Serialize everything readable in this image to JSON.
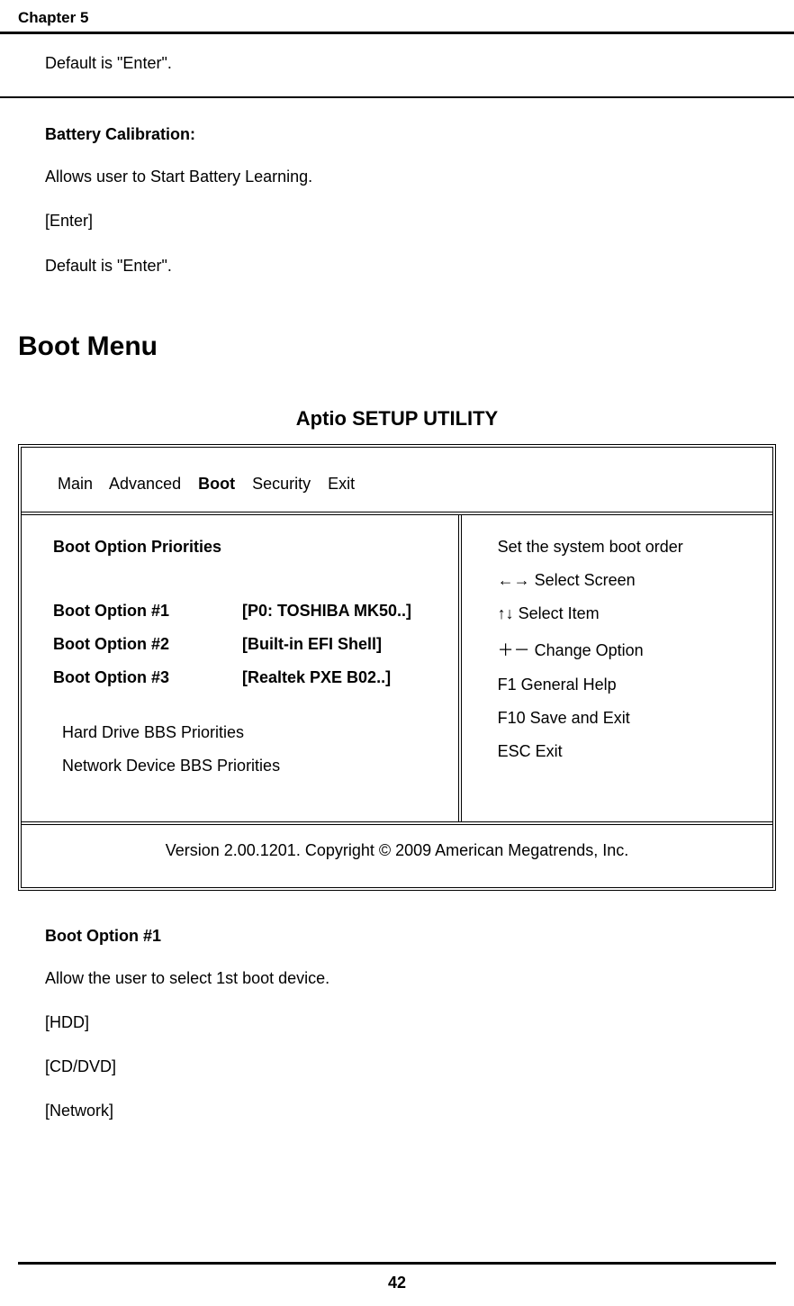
{
  "header": {
    "chapter": "Chapter 5"
  },
  "block1": {
    "default_enter": "Default is \"Enter\"."
  },
  "battery": {
    "title": "Battery Calibration:",
    "desc": "Allows user to Start Battery Learning.",
    "option": "[Enter]",
    "default": "Default is \"Enter\"."
  },
  "boot_menu": {
    "heading": "Boot Menu"
  },
  "setup": {
    "title": "Aptio SETUP UTILITY",
    "tabs": {
      "main": "Main",
      "advanced": "Advanced",
      "boot": "Boot",
      "security": "Security",
      "exit": "Exit"
    },
    "left": {
      "priorities_title": "Boot Option Priorities",
      "rows": [
        {
          "label": "Boot Option #1",
          "value": "[P0: TOSHIBA MK50..]"
        },
        {
          "label": "Boot Option #2",
          "value": "[Built-in EFI Shell]"
        },
        {
          "label": "Boot Option #3",
          "value": "[Realtek PXE B02..]"
        }
      ],
      "bbs1": "Hard Drive BBS Priorities",
      "bbs2": "Network Device BBS Priorities"
    },
    "right": {
      "line1": "Set the system boot order",
      "line2": "←→ Select Screen",
      "line3": "↑↓ Select Item",
      "line4": "＋－ Change Option",
      "line5": "F1  General Help",
      "line6": "F10 Save and Exit",
      "line7": "ESC Exit"
    },
    "footer": "Version 2.00.1201. Copyright © 2009 American Megatrends, Inc."
  },
  "boot_opt1": {
    "title": "Boot Option #1",
    "desc": "Allow the user to select 1st boot device.",
    "opt1": "[HDD]",
    "opt2": "[CD/DVD]",
    "opt3": "[Network]"
  },
  "footer": {
    "page_num": "42"
  }
}
